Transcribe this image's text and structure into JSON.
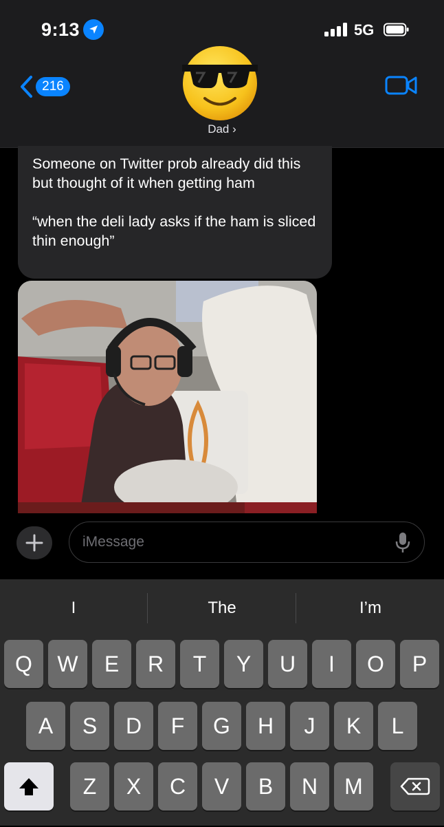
{
  "status": {
    "time": "9:13",
    "network": "5G"
  },
  "header": {
    "back_count": "216",
    "contact_name": "Dad ›"
  },
  "conversation": {
    "message_paragraphs": [
      "Someone on Twitter prob already did this but thought of it when getting ham",
      "“when the deli lady asks if the ham is sliced thin enough”"
    ]
  },
  "input": {
    "placeholder": "iMessage"
  },
  "keyboard": {
    "suggestions": [
      "I",
      "The",
      "I’m"
    ],
    "row1": [
      "Q",
      "W",
      "E",
      "R",
      "T",
      "Y",
      "U",
      "I",
      "O",
      "P"
    ],
    "row2": [
      "A",
      "S",
      "D",
      "F",
      "G",
      "H",
      "J",
      "K",
      "L"
    ],
    "row3": [
      "Z",
      "X",
      "C",
      "V",
      "B",
      "N",
      "M"
    ]
  },
  "colors": {
    "accent": "#0a84ff",
    "bubble": "#262628",
    "keyboard": "#2b2b2b",
    "key": "#6b6b6b"
  },
  "icons": [
    "location-arrow-icon",
    "signal-bars-icon",
    "battery-icon",
    "chevron-left-icon",
    "video-camera-icon",
    "plus-icon",
    "microphone-icon",
    "shift-icon",
    "backspace-icon"
  ]
}
